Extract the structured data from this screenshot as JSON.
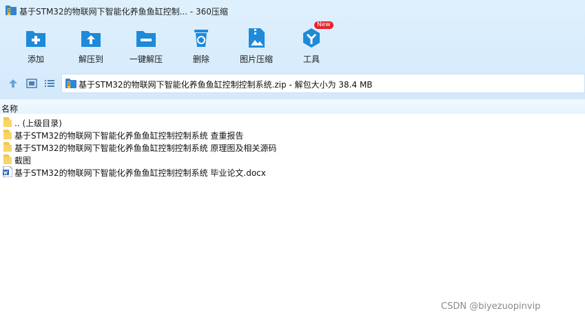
{
  "window": {
    "title": "基于STM32的物联网下智能化养鱼鱼缸控制...  - 360压缩"
  },
  "toolbar": {
    "items": [
      {
        "label": "添加",
        "icon": "add-icon"
      },
      {
        "label": "解压到",
        "icon": "extract-to-icon"
      },
      {
        "label": "一键解压",
        "icon": "one-click-extract-icon"
      },
      {
        "label": "删除",
        "icon": "recycle-bin-icon"
      },
      {
        "label": "图片压缩",
        "icon": "image-compress-icon"
      },
      {
        "label": "工具",
        "icon": "tools-icon",
        "badge": "New"
      }
    ]
  },
  "nav": {
    "address": "基于STM32的物联网下智能化养鱼鱼缸控制控制系统.zip - 解包大小为 38.4 MB"
  },
  "list": {
    "column_name": "名称",
    "items": [
      {
        "name": ".. (上级目录)",
        "type": "folder"
      },
      {
        "name": "基于STM32的物联网下智能化养鱼鱼缸控制控制系统 查重报告",
        "type": "folder"
      },
      {
        "name": "基于STM32的物联网下智能化养鱼鱼缸控制控制系统 原理图及相关源码",
        "type": "folder"
      },
      {
        "name": "截图",
        "type": "folder"
      },
      {
        "name": "基于STM32的物联网下智能化养鱼鱼缸控制控制系统 毕业论文.docx",
        "type": "docx"
      }
    ]
  },
  "watermark": "CSDN @biyezuopinvip",
  "colors": {
    "chrome_bg": "#d7ebfc",
    "icon_blue": "#1e8ad8",
    "badge_red": "#e8222a"
  }
}
